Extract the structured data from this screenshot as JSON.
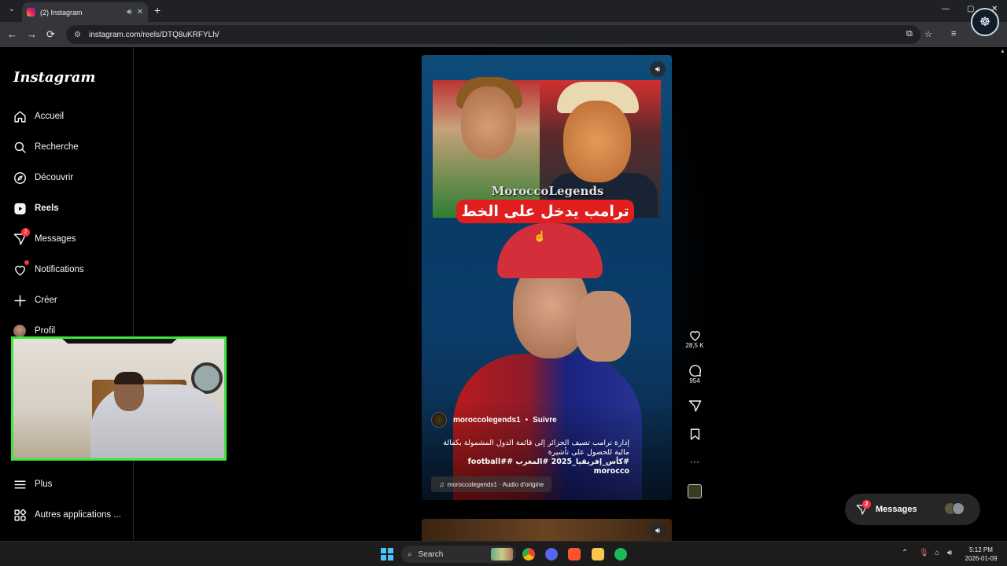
{
  "browser": {
    "tab_title": "(2) Instagram",
    "url": "instagram.com/reels/DTQ8uKRFYLh/",
    "new_tab": "+",
    "close": "✕",
    "back": "←",
    "forward": "→",
    "reload": "⟳",
    "minimize": "—",
    "maximize": "▢",
    "window_close": "✕"
  },
  "sidebar": {
    "logo": "Instagram",
    "items": [
      {
        "label": "Accueil",
        "icon": "home-icon"
      },
      {
        "label": "Recherche",
        "icon": "search-icon"
      },
      {
        "label": "Découvrir",
        "icon": "compass-icon"
      },
      {
        "label": "Reels",
        "icon": "reels-icon"
      },
      {
        "label": "Messages",
        "icon": "messenger-icon",
        "badge": "2"
      },
      {
        "label": "Notifications",
        "icon": "heart-icon"
      },
      {
        "label": "Créer",
        "icon": "plus-icon"
      },
      {
        "label": "Profil",
        "icon": "avatar"
      }
    ],
    "more": "Plus",
    "other_apps": "Autres applications ..."
  },
  "reel": {
    "watermark": "MoroccoLegends",
    "overlay_title": "ترامب يدخل على الخط",
    "author": "moroccolegends1",
    "separator": "•",
    "follow": "Suivre",
    "caption_line1": "إدارة ترامب تصيف الجزائر إلى قائمة الدول المشمولة بكفالة",
    "caption_line2": "مالية للحصول على تأشيرة",
    "caption_tags": "#كأس_إفريقيا_2025 #المغرب #football# morocco",
    "audio": "moroccolegends1 · Audio d'origine",
    "likes": "28,5 K",
    "comments": "954"
  },
  "messages_pill": {
    "label": "Messages",
    "badge": "2"
  },
  "taskbar": {
    "search": "Search",
    "time": "5:12 PM",
    "date": "2026-01-09"
  },
  "colors": {
    "accent_badge": "#ff3040",
    "webcam_border": "#39e639",
    "sidebar_bg": "#000000"
  }
}
